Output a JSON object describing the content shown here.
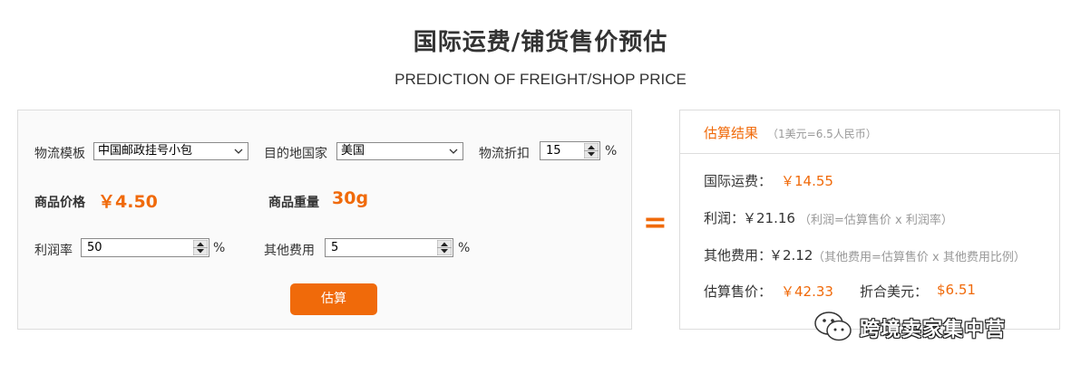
{
  "header": {
    "title": "国际运费/铺货售价预估",
    "subtitle": "PREDICTION OF FREIGHT/SHOP PRICE"
  },
  "form": {
    "logistics_template_label": "物流模板",
    "logistics_template_value": "中国邮政挂号小包",
    "destination_label": "目的地国家",
    "destination_value": "美国",
    "discount_label": "物流折扣",
    "discount_value": "15",
    "discount_unit": "%",
    "price_label": "商品价格",
    "price_value": "￥4.50",
    "weight_label": "商品重量",
    "weight_value": "30g",
    "profit_label": "利润率",
    "profit_value": "50",
    "profit_unit": "%",
    "other_fee_label": "其他费用",
    "other_fee_value": "5",
    "other_fee_unit": "%",
    "estimate_button": "估算"
  },
  "equals_sign": "=",
  "result": {
    "title": "估算结果",
    "rate_note": "（1美元=6.5人民币）",
    "freight_label": "国际运费：",
    "freight_value": "￥14.55",
    "profit_label": "利润：",
    "profit_value": "￥21.16",
    "profit_note": "（利润=估算售价 x 利润率）",
    "other_label": "其他费用：",
    "other_value": "￥2.12",
    "other_note": "（其他费用=估算售价 x 其他费用比例）",
    "price_label": "估算售价：",
    "price_value": "￥42.33",
    "usd_label": "折合美元：",
    "usd_value": "$6.51"
  },
  "watermark": {
    "text": "跨境卖家集中营",
    "icon": "wechat-icon"
  },
  "colors": {
    "accent": "#f06a0a",
    "muted": "#999999",
    "text": "#333333",
    "border": "#dddddd"
  }
}
